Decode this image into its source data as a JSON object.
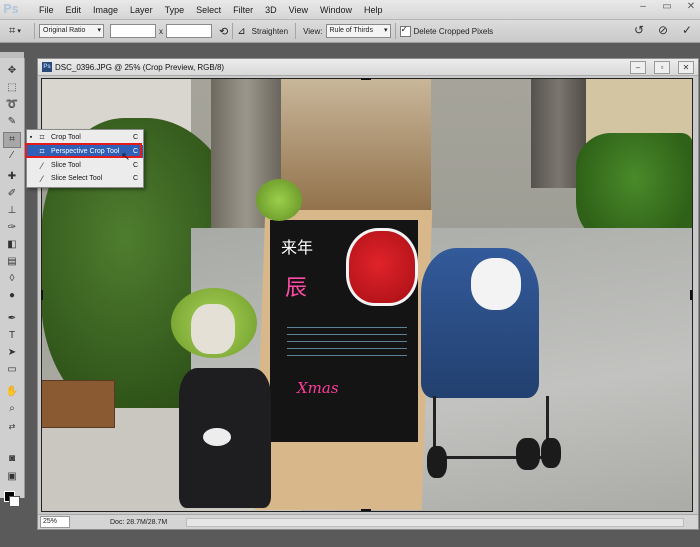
{
  "app": {
    "logo": "Ps"
  },
  "menubar": {
    "items": [
      "File",
      "Edit",
      "Image",
      "Layer",
      "Type",
      "Select",
      "Filter",
      "3D",
      "View",
      "Window",
      "Help"
    ]
  },
  "options": {
    "ratio_select": "Original Ratio",
    "ratio_width": "",
    "ratio_height": "",
    "x_label": "x",
    "straighten_label": "Straighten",
    "view_label": "View:",
    "view_select": "Rule of Thirds",
    "delete_cropped_label": "Delete Cropped Pixels",
    "delete_cropped_checked": true
  },
  "document": {
    "title": "DSC_0396.JPG @ 25% (Crop Preview, RGB/8)",
    "zoom": "25%",
    "doc_size": "Doc: 28.7M/28.7M"
  },
  "flyout": {
    "items": [
      {
        "label": "Crop Tool",
        "shortcut": "C",
        "icon": "crop-icon",
        "current": true
      },
      {
        "label": "Perspective Crop Tool",
        "shortcut": "C",
        "icon": "perspective-crop-icon",
        "highlighted": true
      },
      {
        "label": "Slice Tool",
        "shortcut": "C",
        "icon": "slice-icon"
      },
      {
        "label": "Slice Select Tool",
        "shortcut": "C",
        "icon": "slice-select-icon"
      }
    ]
  },
  "colors": {
    "highlight": "#2f5fb6",
    "annotation_box": "#e41b1b"
  }
}
